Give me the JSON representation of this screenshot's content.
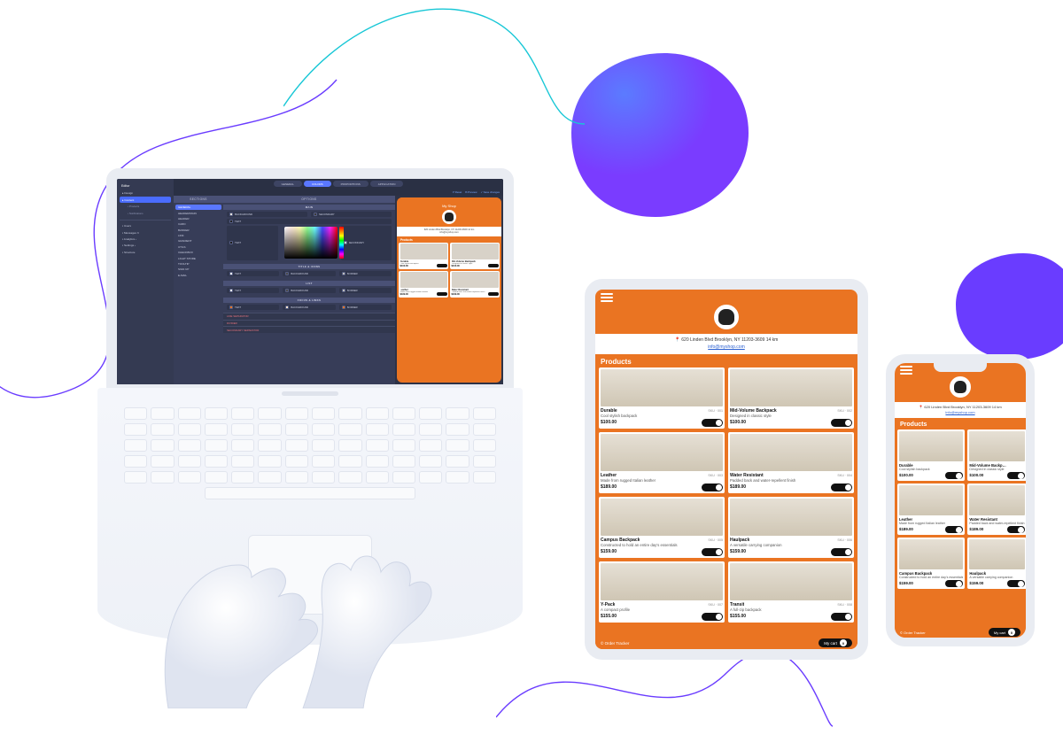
{
  "editor": {
    "side": {
      "title": "Editor",
      "tree": [
        "Design",
        "Content"
      ],
      "tree_active": 1,
      "subtree": [
        "Products",
        "Notifications"
      ],
      "groups": [
        {
          "icon": "users",
          "label": "Users"
        },
        {
          "icon": "chat",
          "label": "Messages",
          "badge": "3"
        },
        {
          "icon": "chart",
          "label": "Analytics",
          "badge": "›"
        },
        {
          "icon": "gear",
          "label": "Settings",
          "badge": "›"
        },
        {
          "icon": "layers",
          "label": "Structure"
        }
      ]
    },
    "tabs": [
      "GENERAL",
      "COLORS",
      "PROPORTIONS",
      "APPLICATION"
    ],
    "tabs_active": 1,
    "toolbar": [
      "↺ Reset",
      "⧉ Preview",
      "✓ Save changes"
    ],
    "sections_header": "SECTIONS",
    "sections": [
      "GENERAL",
      "HEADER/MAIN",
      "HEADER",
      "CARD",
      "BANNER",
      "LINK",
      "GRADIENT",
      "UTILS",
      "CHECKBOX",
      "LIGHT STORE",
      "TOOLTIP",
      "SIGN UP",
      "E-MAIL"
    ],
    "sections_active": 0,
    "options_header": "OPTIONS",
    "prop_groups": [
      {
        "title": "MAIN",
        "rows": [
          [
            {
              "c": "#e3e0da",
              "t": "BACKGROUND"
            },
            {
              "c": "#3b3b3b",
              "t": "SECONDARY"
            }
          ],
          [
            {
              "c": "#222222",
              "t": "TEXT"
            }
          ],
          [
            {
              "c": "#1d1d1d",
              "t": "TEXT",
              "picker": true
            },
            {
              "c": "#cfd0d3",
              "t": "SECONDARY"
            }
          ]
        ]
      },
      {
        "title": "TITLE & ICONS",
        "rows": [
          [
            {
              "c": "#ffffff",
              "t": "TEXT"
            },
            {
              "c": "#4b4b4b",
              "t": "BACKGROUND"
            },
            {
              "c": "#bdbdbd",
              "t": "BORDER"
            }
          ]
        ]
      },
      {
        "title": "LIST",
        "rows": [
          [
            {
              "c": "#ffffff",
              "t": "TEXT"
            },
            {
              "c": "#4b4b4b",
              "t": "BACKGROUND"
            },
            {
              "c": "#bdbdbd",
              "t": "BORDER"
            }
          ]
        ]
      },
      {
        "title": "FOCUS & LINKS",
        "rows": [
          [
            {
              "c": "#ea7422",
              "t": "TEXT"
            },
            {
              "c": "#ffe5d0",
              "t": "BACKGROUND"
            },
            {
              "c": "#ea7422",
              "t": "BORDER"
            }
          ]
        ]
      }
    ],
    "dividers": [
      "LINE SEPARATOR",
      "DIVIDER",
      "SECONDARY SEPARATOR"
    ]
  },
  "shop": {
    "title": "My Shop",
    "address": "620 Linden Blvd Brooklyn, NY 11203-3609 14 km",
    "email": "info@myshop.com",
    "section": "Products",
    "footer_left": "© Order Tracker",
    "cart_label": "My cart",
    "cart_count": "0",
    "products": [
      {
        "name": "Durable",
        "desc": "Cool stylish backpack",
        "price": "$100.00",
        "sku": "SKU · 001"
      },
      {
        "name": "Mid-Volume Backpack",
        "desc": "Designed in classic style",
        "price": "$100.00",
        "sku": "SKU · 002"
      },
      {
        "name": "Leather",
        "desc": "Made from rugged Italian leather",
        "price": "$189.00",
        "sku": "SKU · 003"
      },
      {
        "name": "Water Resistant",
        "desc": "Padded back and water-repellent finish",
        "price": "$189.00",
        "sku": "SKU · 004"
      },
      {
        "name": "Campus Backpack",
        "desc": "Constructed to hold an entire day's essentials",
        "price": "$159.00",
        "sku": "SKU · 005"
      },
      {
        "name": "Haulpack",
        "desc": "A versatile carrying companion",
        "price": "$159.00",
        "sku": "SKU · 006"
      },
      {
        "name": "Y-Pack",
        "desc": "A compact profile",
        "price": "$155.00",
        "sku": "SKU · 007"
      },
      {
        "name": "Transit",
        "desc": "A full-zip backpack",
        "price": "$155.00",
        "sku": "SKU · 008"
      }
    ],
    "phone_products": [
      0,
      1,
      2,
      3,
      4,
      5
    ]
  }
}
